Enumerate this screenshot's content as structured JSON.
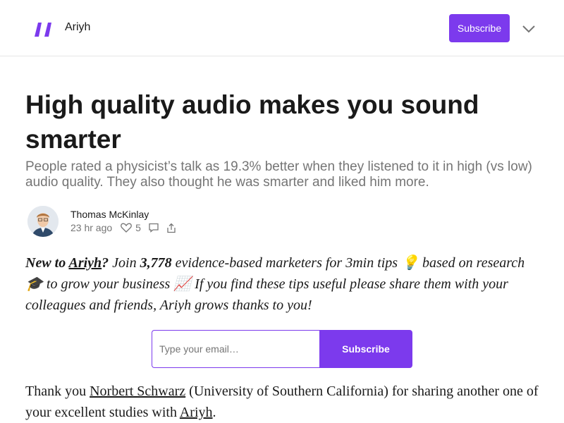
{
  "header": {
    "logo_icon": "quote-mark-icon",
    "publication_name": "Ariyh",
    "subscribe_label": "Subscribe",
    "menu_icon": "chevron-down-icon",
    "accent_color": "#7c3aed"
  },
  "post": {
    "title": "High quality audio makes you sound smarter",
    "subtitle": "People rated a physicist’s talk as 19.3% better when they listened to it in high (vs low) audio quality. They also thought he was smarter and liked him more.",
    "author": "Thomas McKinlay",
    "date": "23 hr ago",
    "likes": "5",
    "like_icon": "heart-icon",
    "comment_icon": "comment-icon",
    "share_icon": "share-icon"
  },
  "intro": {
    "bold_prefix": "New to ",
    "link": "Ariyh",
    "bold_suffix": "?",
    "join_text": " Join ",
    "count": "3,778",
    "text1": " evidence-based marketers for 3min tips 💡 based on research 🎓 to grow your business 📈 If you find these tips useful please share them with your colleagues and friends, Ariyh grows thanks to you!"
  },
  "subscribe_form": {
    "placeholder": "Type your email…",
    "button_label": "Subscribe"
  },
  "body": {
    "text_before": "Thank you ",
    "link1": "Norbert Schwarz",
    "text_middle": " (University of Southern California) for sharing another one of your excellent studies with ",
    "link2": "Ariyh",
    "text_after": "."
  }
}
